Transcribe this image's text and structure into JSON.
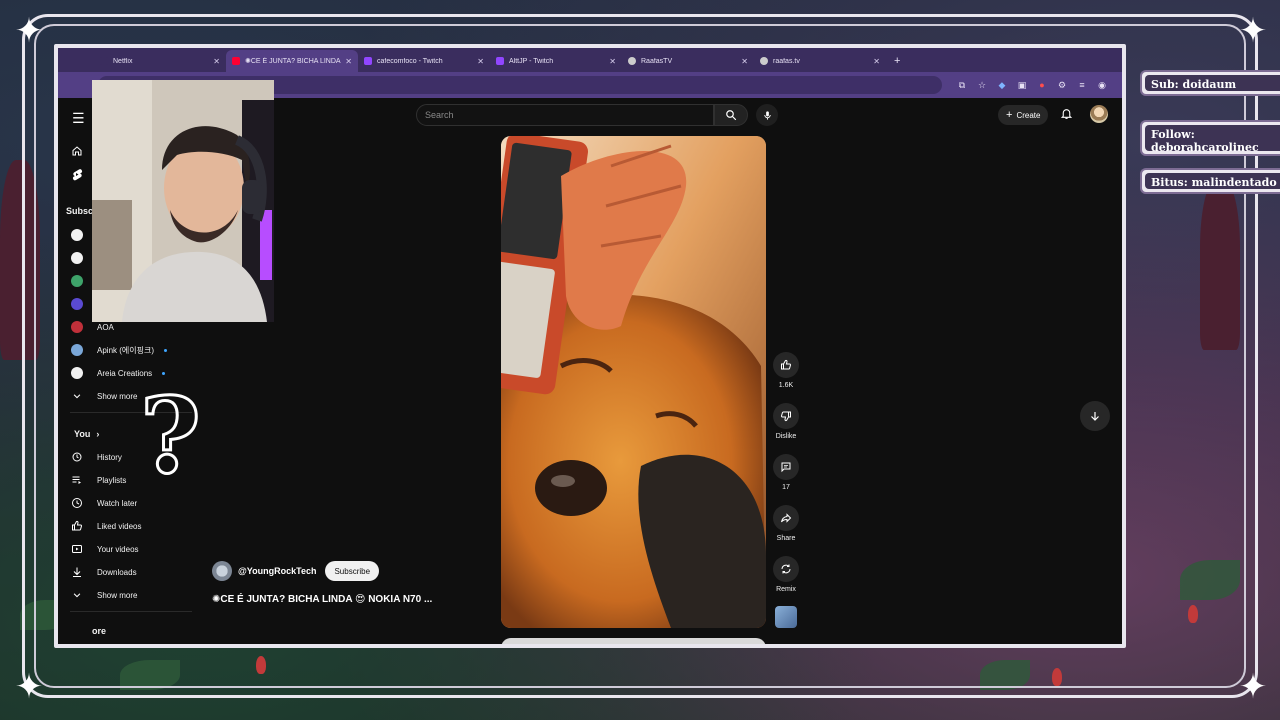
{
  "browser": {
    "tabs": [
      {
        "label": "Netflix",
        "favicon_color": "#3a2d5e",
        "active": false
      },
      {
        "label": "✺CE É JUNTA? BICHA LINDA 😍",
        "favicon_color": "#ff0033",
        "active": true
      },
      {
        "label": "cafecomfoco - Twitch",
        "favicon_color": "#9146ff",
        "active": false
      },
      {
        "label": "AlttJP - Twitch",
        "favicon_color": "#9146ff",
        "active": false
      },
      {
        "label": "RaafasTV",
        "favicon_color": "#cccccc",
        "active": false
      },
      {
        "label": "raafas.tv",
        "favicon_color": "#cccccc",
        "active": false
      }
    ],
    "new_tab": "+"
  },
  "youtube": {
    "search_placeholder": "Search",
    "create_label": "Create",
    "sidebar": {
      "subscriptions_heading": "Subsc",
      "channels": [
        {
          "label": "",
          "avatar": "#f1f1f1"
        },
        {
          "label": "",
          "avatar": "#f1f1f1"
        },
        {
          "label": "",
          "avatar": "#3ea36a"
        },
        {
          "label": "",
          "avatar": "#5a4ad1"
        },
        {
          "label": "AOA",
          "avatar": "#c0303a"
        },
        {
          "label": "Apink (에이핑크)",
          "avatar": "#7aa7d8"
        },
        {
          "label": "Areia Creations",
          "avatar": "#f1f1f1"
        }
      ],
      "show_more_1": "Show more",
      "you_heading": "You",
      "you_items": [
        {
          "label": "History",
          "icon": "history-icon"
        },
        {
          "label": "Playlists",
          "icon": "playlists-icon"
        },
        {
          "label": "Watch later",
          "icon": "watch-later-icon"
        },
        {
          "label": "Liked videos",
          "icon": "liked-icon"
        },
        {
          "label": "Your videos",
          "icon": "your-videos-icon"
        },
        {
          "label": "Downloads",
          "icon": "downloads-icon"
        }
      ],
      "show_more_2": "Show more",
      "explore_partial": "ore"
    },
    "short": {
      "channel": "@YoungRockTech",
      "subscribe_label": "Subscribe",
      "title": "✺CE É JUNTA? BICHA LINDA 😍 NOKIA N70 ...",
      "likes": "1.6K",
      "dislike_label": "Dislike",
      "comments": "17",
      "share_label": "Share",
      "remix_label": "Remix"
    }
  },
  "overlay": {
    "sub": "Sub: doidaum",
    "follow": "Follow: deborahcarolinec",
    "bits": "Bitus: malindentado",
    "question_mark": "?"
  }
}
